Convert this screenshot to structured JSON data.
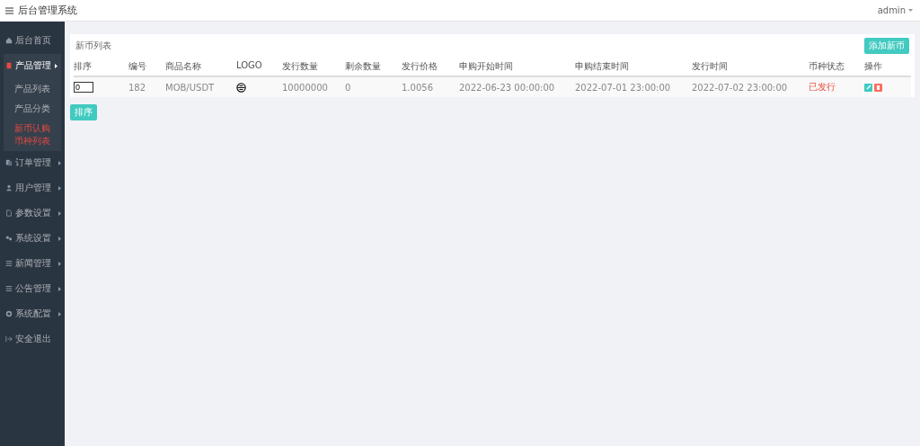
{
  "header": {
    "title": "后台管理系统",
    "user": "admin"
  },
  "sidebar": {
    "items": [
      {
        "label": "后台首页",
        "selected": false,
        "kind": "link"
      },
      {
        "label": "产品管理",
        "selected": true,
        "kind": "menu",
        "expanded": true,
        "children": [
          {
            "label": "产品列表",
            "selected": false
          },
          {
            "label": "产品分类",
            "selected": false
          },
          {
            "label": "新币认购币种列表",
            "selected": true
          }
        ]
      },
      {
        "label": "订单管理",
        "selected": false,
        "kind": "menu"
      },
      {
        "label": "用户管理",
        "selected": false,
        "kind": "menu"
      },
      {
        "label": "参数设置",
        "selected": false,
        "kind": "menu"
      },
      {
        "label": "系统设置",
        "selected": false,
        "kind": "menu"
      },
      {
        "label": "新闻管理",
        "selected": false,
        "kind": "menu"
      },
      {
        "label": "公告管理",
        "selected": false,
        "kind": "menu"
      },
      {
        "label": "系统配置",
        "selected": false,
        "kind": "menu"
      },
      {
        "label": "安全退出",
        "selected": false,
        "kind": "link"
      }
    ]
  },
  "panel": {
    "title": "新币列表",
    "add_button": "添加新币",
    "table": {
      "columns": [
        "排序",
        "编号",
        "商品名称",
        "LOGO",
        "发行数量",
        "剩余数量",
        "发行价格",
        "申购开始时间",
        "申购结束时间",
        "发行时间",
        "币种状态",
        "操作"
      ],
      "rows": [
        {
          "sort": "0",
          "id": "182",
          "name": "MOB/USDT",
          "issued": "10000000",
          "remaining": "0",
          "price": "1.0056",
          "start": "2022-06-23 00:00:00",
          "end": "2022-07-01 23:00:00",
          "issue_time": "2022-07-02 23:00:00",
          "status": "已发行"
        }
      ]
    }
  },
  "sort_button": "排序"
}
